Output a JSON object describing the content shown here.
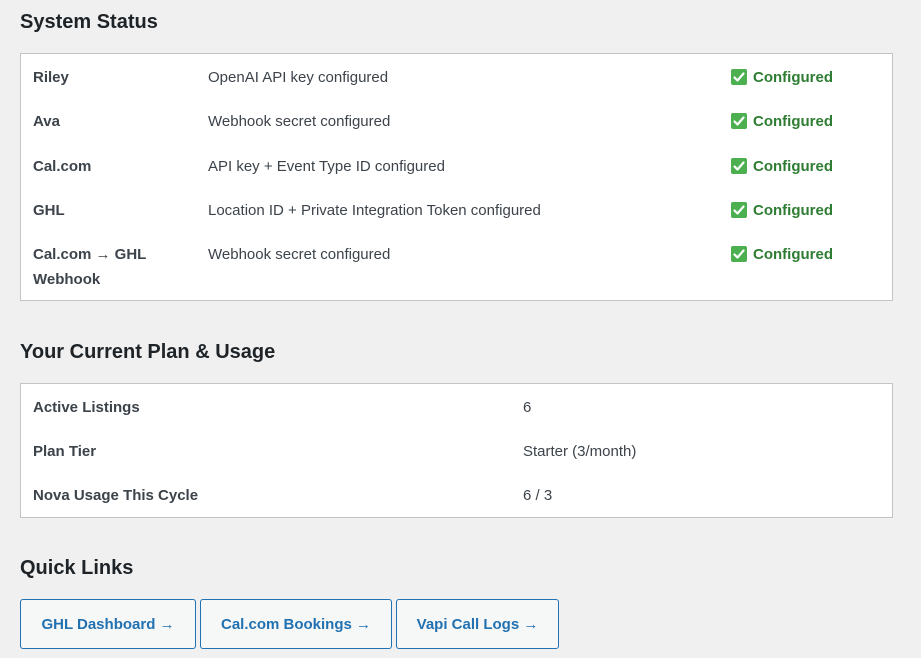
{
  "system_status": {
    "title": "System Status",
    "rows": [
      {
        "name": "Riley",
        "description": "OpenAI API key configured",
        "status": "Configured"
      },
      {
        "name": "Ava",
        "description": "Webhook secret configured",
        "status": "Configured"
      },
      {
        "name": "Cal.com",
        "description": "API key + Event Type ID configured",
        "status": "Configured"
      },
      {
        "name": "GHL",
        "description": "Location ID + Private Integration Token configured",
        "status": "Configured"
      },
      {
        "name": "Cal.com → GHL Webhook",
        "description": "Webhook secret configured",
        "status": "Configured"
      }
    ]
  },
  "plan": {
    "title": "Your Current Plan & Usage",
    "rows": [
      {
        "label": "Active Listings",
        "value": "6"
      },
      {
        "label": "Plan Tier",
        "value": "Starter (3/month)"
      },
      {
        "label": "Nova Usage This Cycle",
        "value": "6 / 3"
      }
    ]
  },
  "quick_links": {
    "title": "Quick Links",
    "buttons": [
      {
        "label": "GHL Dashboard →"
      },
      {
        "label": "Cal.com Bookings →"
      },
      {
        "label": "Vapi Call Logs →"
      }
    ]
  },
  "colors": {
    "accent": "#2271b1",
    "success": "#2e7d32",
    "check_bg": "#4caf50",
    "page_bg": "#f0f0f1"
  },
  "icons": {
    "status_check": "check-box-icon"
  }
}
